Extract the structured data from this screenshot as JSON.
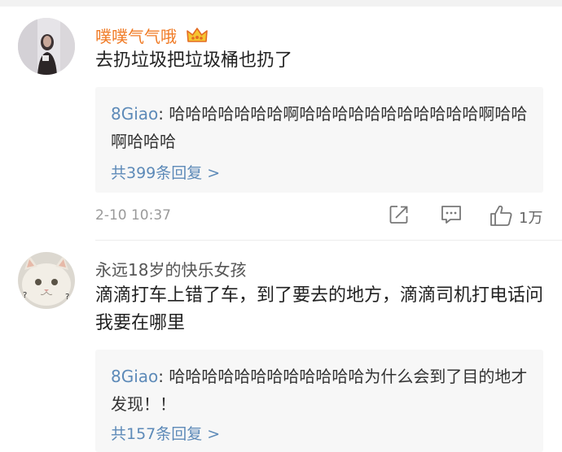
{
  "comments": [
    {
      "username": "噗噗气气哦",
      "username_color": "#f07a24",
      "badge_icon": "crown-icon",
      "content": "去扔垃圾把垃圾桶也扔了",
      "reply": {
        "author": "8Giao",
        "separator": ": ",
        "text": "哈哈哈哈哈哈哈啊哈哈哈哈哈哈哈哈哈哈哈啊哈哈啊哈哈哈"
      },
      "more_replies": "共399条回复 >",
      "timestamp": "2-10 10:37",
      "like_count": "1万"
    },
    {
      "username": "永远18岁的快乐女孩",
      "username_color": "#555555",
      "content": "滴滴打车上错了车，到了要去的地方，滴滴司机打电话问我要在哪里",
      "reply": {
        "author": "8Giao",
        "separator": ": ",
        "text": "哈哈哈哈哈哈哈哈哈哈哈哈为什么会到了目的地才发现！！"
      },
      "more_replies": "共157条回复 >"
    }
  ],
  "icons": {
    "share": "share-icon",
    "comment": "comment-icon",
    "like": "thumbs-up-icon"
  },
  "colors": {
    "link_blue": "#5d8ab8",
    "reply_bg": "#f7f7f7",
    "divider": "#f2f2f2"
  }
}
